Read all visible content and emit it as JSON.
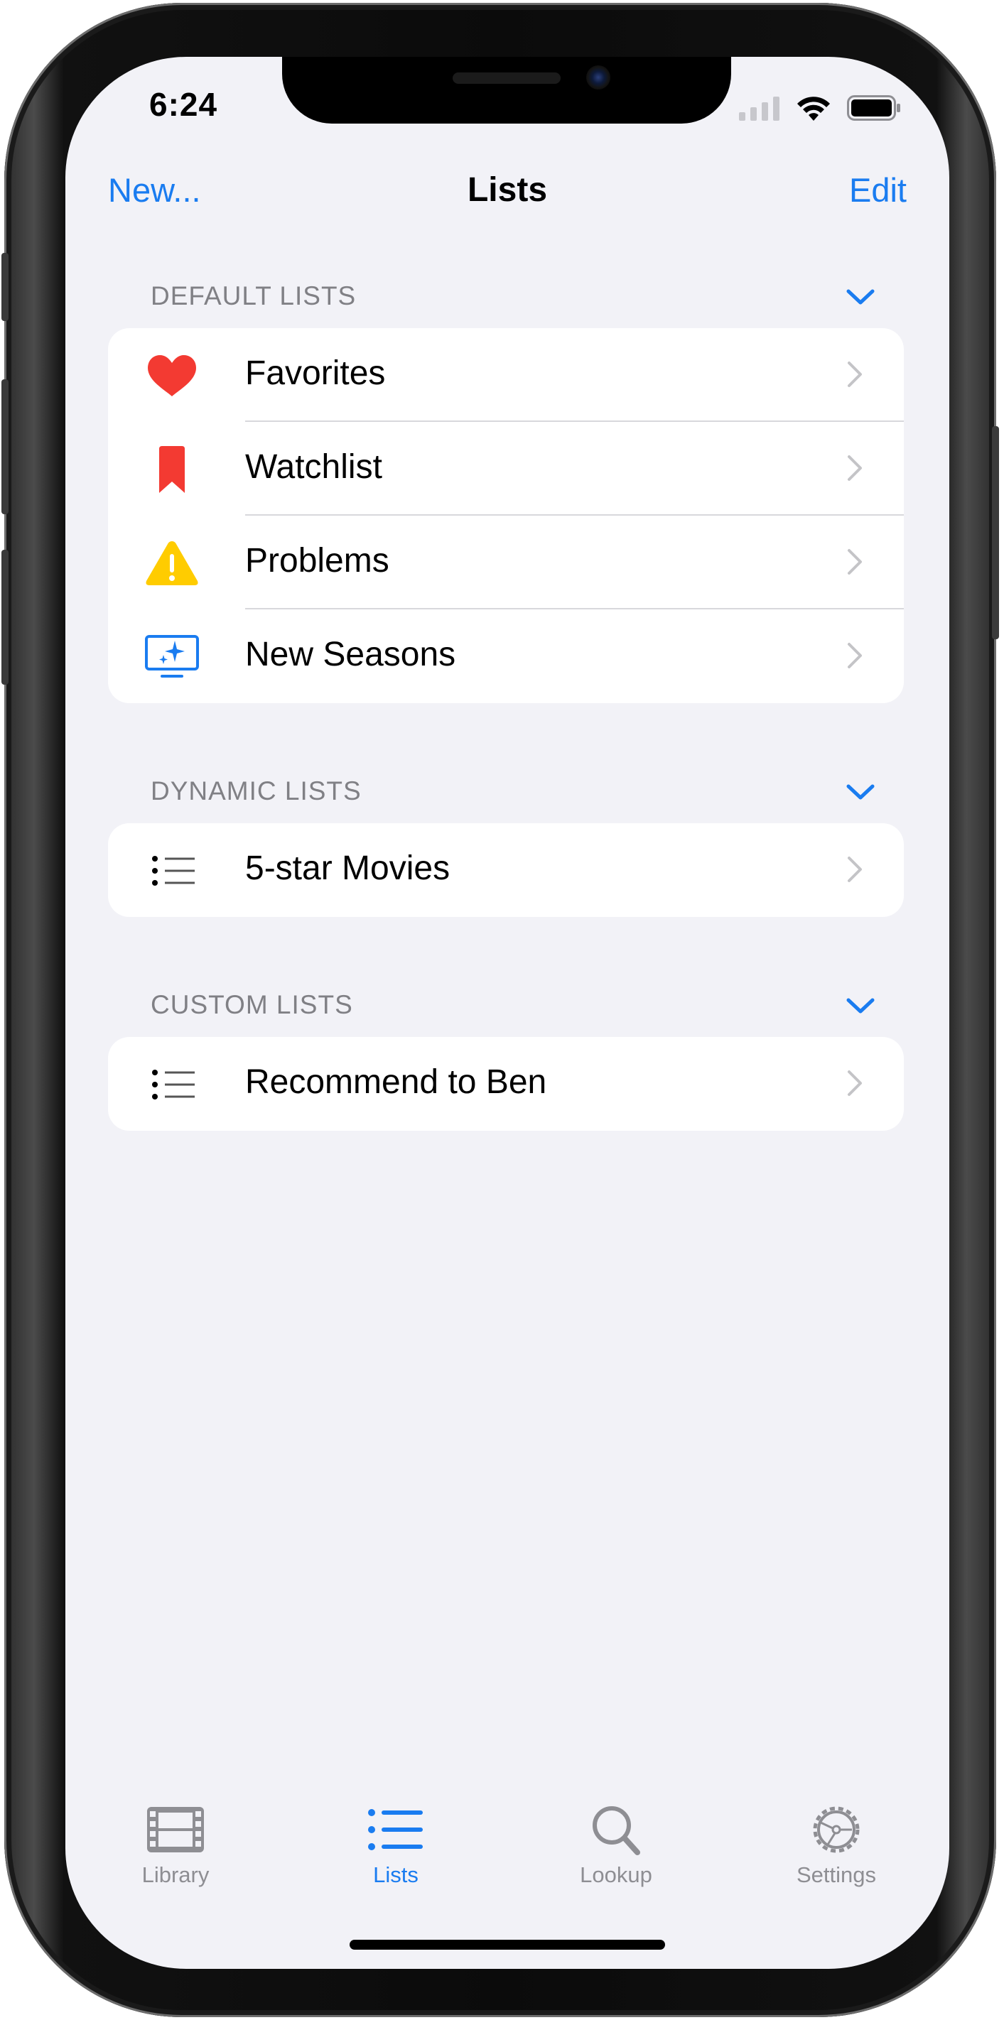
{
  "status_bar": {
    "time": "6:24"
  },
  "nav": {
    "left_button": "New...",
    "title": "Lists",
    "right_button": "Edit"
  },
  "sections": [
    {
      "title": "DEFAULT LISTS",
      "rows": [
        {
          "label": "Favorites",
          "icon": "heart-icon"
        },
        {
          "label": "Watchlist",
          "icon": "bookmark-icon"
        },
        {
          "label": "Problems",
          "icon": "warning-icon"
        },
        {
          "label": "New Seasons",
          "icon": "tv-sparkle-icon"
        }
      ]
    },
    {
      "title": "DYNAMIC LISTS",
      "rows": [
        {
          "label": "5-star Movies",
          "icon": "list-icon"
        }
      ]
    },
    {
      "title": "CUSTOM LISTS",
      "rows": [
        {
          "label": "Recommend to Ben",
          "icon": "list-icon"
        }
      ]
    }
  ],
  "tabbar": {
    "tabs": [
      {
        "label": "Library",
        "icon": "film-icon",
        "active": false
      },
      {
        "label": "Lists",
        "icon": "list-bullet-icon",
        "active": true
      },
      {
        "label": "Lookup",
        "icon": "search-icon",
        "active": false
      },
      {
        "label": "Settings",
        "icon": "gear-icon",
        "active": false
      }
    ]
  },
  "colors": {
    "accent": "#1a7cf0",
    "background": "#f2f2f7",
    "heart": "#f33a32",
    "bookmark": "#f33a32",
    "warning": "#ffcc00",
    "secondary_text": "#808085"
  }
}
